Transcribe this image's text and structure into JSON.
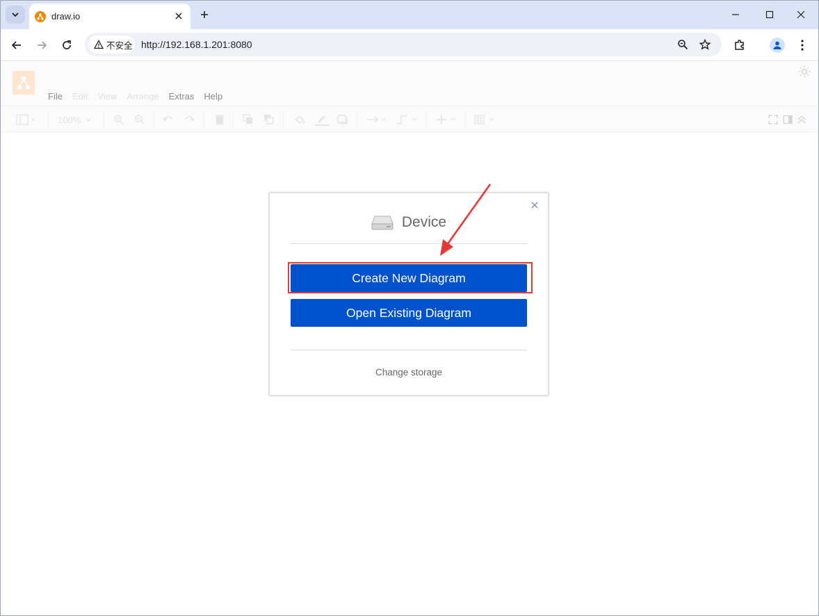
{
  "browser": {
    "tab_title": "draw.io",
    "security_label": "不安全",
    "url": "http://192.168.1.201:8080"
  },
  "app": {
    "menu": [
      {
        "label": "File",
        "enabled": true
      },
      {
        "label": "Edit",
        "enabled": false
      },
      {
        "label": "View",
        "enabled": false
      },
      {
        "label": "Arrange",
        "enabled": false
      },
      {
        "label": "Extras",
        "enabled": true
      },
      {
        "label": "Help",
        "enabled": true
      }
    ],
    "zoom": "100%",
    "accent_color": "#f08705"
  },
  "dialog": {
    "title": "Device",
    "create_button": "Create New Diagram",
    "open_button": "Open Existing Diagram",
    "change_storage": "Change storage",
    "button_color": "#0052cc"
  },
  "annotation": {
    "highlight_color": "#e53935"
  }
}
